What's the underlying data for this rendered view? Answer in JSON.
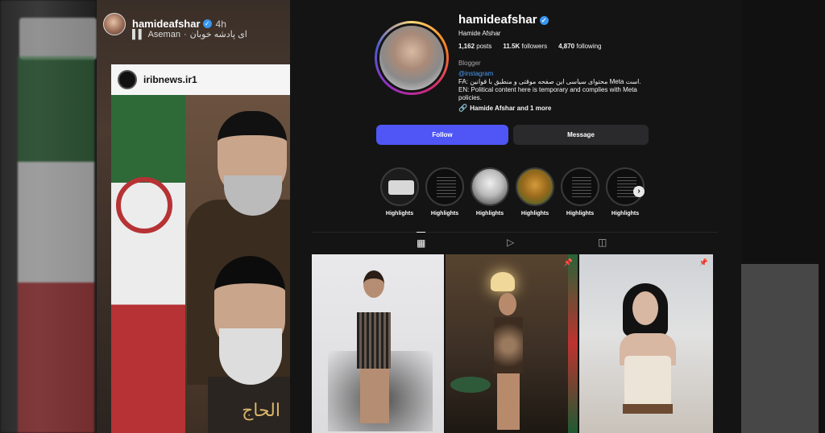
{
  "story": {
    "username": "hamideafshar",
    "time": "4h",
    "music_artist": "Aseman",
    "music_song": "ای پادشه خوبان",
    "repost_account": "iribnews.ir1",
    "calligraphy": "الحاج"
  },
  "profile": {
    "username": "hamideafshar",
    "full_name": "Hamide Afshar",
    "posts_count": "1,162",
    "posts_label": "posts",
    "followers_count": "11.5K",
    "followers_label": "followers",
    "following_count": "4,870",
    "following_label": "following",
    "category": "Blogger",
    "bio_link": "@instagram",
    "bio_fa": "FA: محتوای سیاسی این صفحه موقتی و منطبق با قوانین Meta است.",
    "bio_en": "EN: Political content here is temporary and complies with Meta policies.",
    "followed_by": "Hamide Afshar and 1 more",
    "follow_button": "Follow",
    "message_button": "Message"
  },
  "highlights": [
    {
      "label": "Highlights"
    },
    {
      "label": "Highlights"
    },
    {
      "label": "Highlights"
    },
    {
      "label": "Highlights"
    },
    {
      "label": "Highlights"
    },
    {
      "label": "Highlights"
    }
  ],
  "icons": {
    "next": "›",
    "tab_posts": "▦",
    "tab_reels": "▷",
    "tab_tagged": "◫",
    "pin": "📌",
    "verified": "✓",
    "music": "▌▌",
    "link": "🔗"
  },
  "colors": {
    "follow_button": "#4f56f5",
    "message_button": "#2a2a2d",
    "link": "#4a9cf5",
    "background": "#141414"
  }
}
